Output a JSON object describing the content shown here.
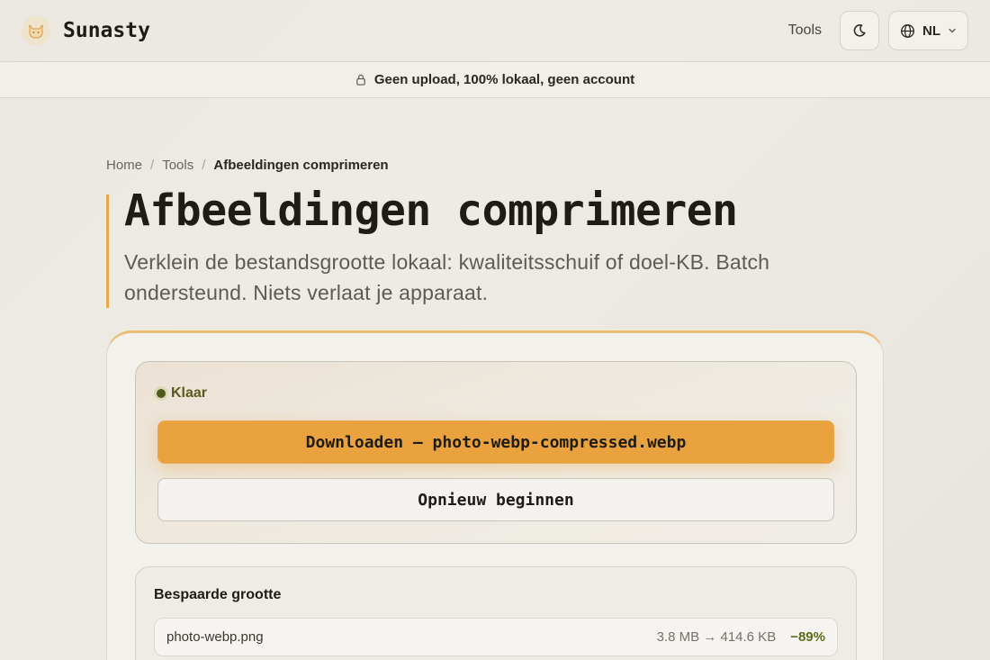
{
  "header": {
    "brand": "Sunasty",
    "nav_tools": "Tools",
    "language": "NL",
    "icons": {
      "logo": "cat-logo-icon",
      "theme": "moon-icon",
      "language": "globe-icon",
      "language_dropdown": "chevron-down-icon"
    }
  },
  "banner": {
    "text": "Geen upload, 100% lokaal, geen account",
    "icon": "lock-icon"
  },
  "breadcrumb": {
    "items": [
      "Home",
      "Tools",
      "Afbeeldingen comprimeren"
    ],
    "separator": "/"
  },
  "page": {
    "title": "Afbeeldingen comprimeren",
    "subtitle": "Verklein de bestandsgrootte lokaal: kwaliteitsschuif of doel-KB. Batch ondersteund. Niets verlaat je apparaat."
  },
  "result": {
    "status": "Klaar",
    "download_label": "Downloaden — photo-webp-compressed.webp",
    "restart_label": "Opnieuw beginnen"
  },
  "savings": {
    "title": "Bespaarde grootte",
    "files": [
      {
        "name": "photo-webp.png",
        "sizes": "3.8 MB → 414.6 KB",
        "percent": "−89%"
      }
    ]
  },
  "colors": {
    "accent": "#e9a23e",
    "status_ok": "#5a5a1e",
    "savings_positive": "#5e6b1c"
  }
}
